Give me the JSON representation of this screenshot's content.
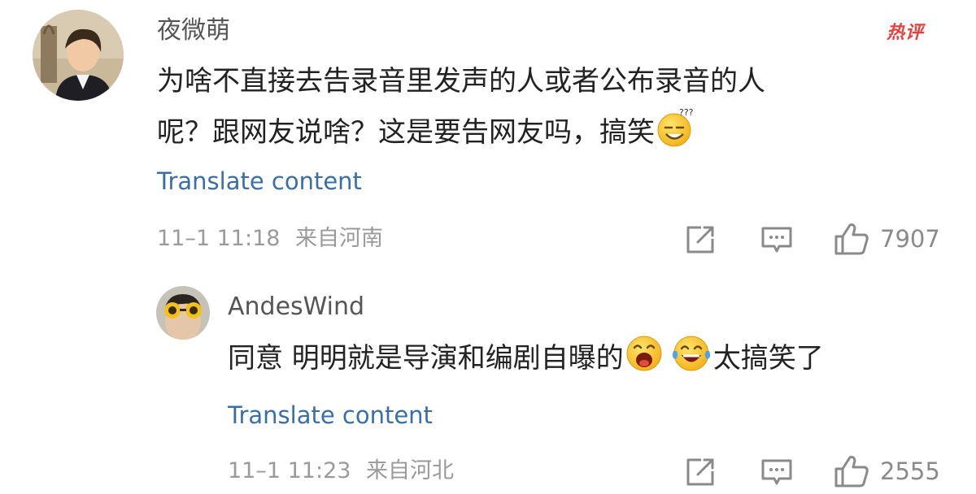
{
  "comments": [
    {
      "username": "夜微萌",
      "hot_badge": "热评",
      "text_line1": "为啥不直接去告录音里发声的人或者公布录音的人",
      "text_line2": "呢？跟网友说啥？这是要告网友吗，搞笑",
      "translate_label": "Translate content",
      "timestamp": "11–1 11:18",
      "location": "来自河南",
      "like_count": "7907",
      "icons": [
        "share-icon",
        "reply-icon",
        "like-icon"
      ]
    }
  ],
  "replies": [
    {
      "username": "AndesWind",
      "text_part1": "同意 明明就是导演和编剧自曝的",
      "text_part2": "太搞笑了",
      "translate_label": "Translate content",
      "timestamp": "11–1 11:23",
      "location": "来自河北",
      "like_count": "2555",
      "icons": [
        "share-icon",
        "reply-icon",
        "like-icon"
      ]
    }
  ],
  "colors": {
    "hot_badge": "#e8403f",
    "translate_link": "#3a6fa6",
    "meta_text": "#9a9a9a",
    "body_text": "#222222"
  }
}
